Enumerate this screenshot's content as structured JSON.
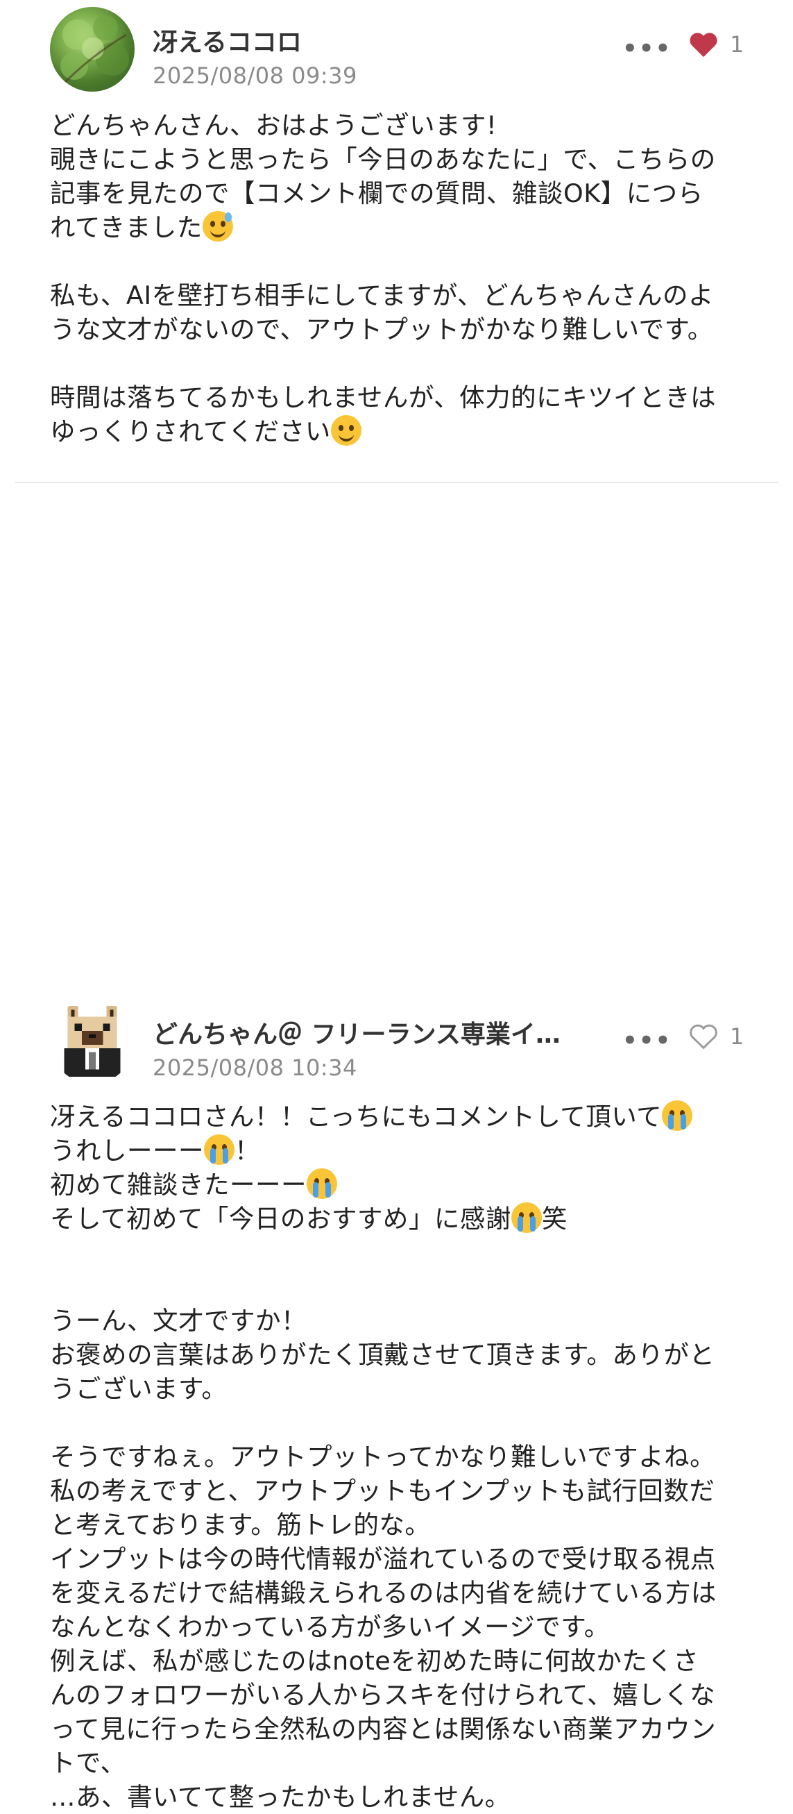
{
  "comments": [
    {
      "author": "冴えるココロ",
      "date": "2025/08/08 09:39",
      "likes": "1",
      "liked": true,
      "avatar_icon": "tree-photo-avatar",
      "paragraphs": [
        [
          "どんちゃんさん、おはようございます!",
          "覗きにこようと思ったら「今日のあなたに」で、こちらの",
          "記事を見たので【コメント欄での質問、雑談OK】につら",
          "れてきました"
        ],
        [
          "私も、AIを壁打ち相手にしてますが、どんちゃんさんのよ",
          "うな文才がないので、アウトプットがかなり難しいです。"
        ],
        [
          "時間は落ちてるかもしれませんが、体力的にキツイときは",
          "ゆっくりされてください"
        ]
      ]
    },
    {
      "author": "どんちゃん＠ フリーランス専業イ…",
      "date": "2025/08/08 10:34",
      "likes": "1",
      "liked": false,
      "avatar_icon": "pixel-dog-avatar",
      "para_a": [
        "冴えるココロさん！！こっちにもコメントして頂いて",
        "うれしーーー",
        "！"
      ],
      "para_b": [
        "初めて雑談きたーーー"
      ],
      "para_c": [
        "そして初めて「今日のおすすめ」に感謝",
        "笑"
      ],
      "para_d": [
        "うーん、文才ですか！",
        "お褒めの言葉はありがたく頂戴させて頂きます。ありがと",
        "うございます。"
      ],
      "para_e": [
        "そうですねぇ。アウトプットってかなり難しいですよね。",
        "私の考えですと、アウトプットもインプットも試行回数だ",
        "と考えております。筋トレ的な。",
        "インプットは今の時代情報が溢れているので受け取る視点",
        "を変えるだけで結構鍛えられるのは内省を続けている方は",
        "なんとなくわかっている方が多いイメージです。",
        "例えば、私が感じたのはnoteを初めた時に何故かたくさ",
        "んのフォロワーがいる人からスキを付けられて、嬉しくな",
        "って見に行ったら全然私の内容とは関係ない商業アカウン",
        "トで、",
        "…あ、書いてて整ったかもしれません。"
      ]
    }
  ],
  "more_icon": "•••",
  "colors": {
    "liked": "#c0394b",
    "unliked": "#9a9a9a",
    "divider": "#e6e6e6"
  }
}
